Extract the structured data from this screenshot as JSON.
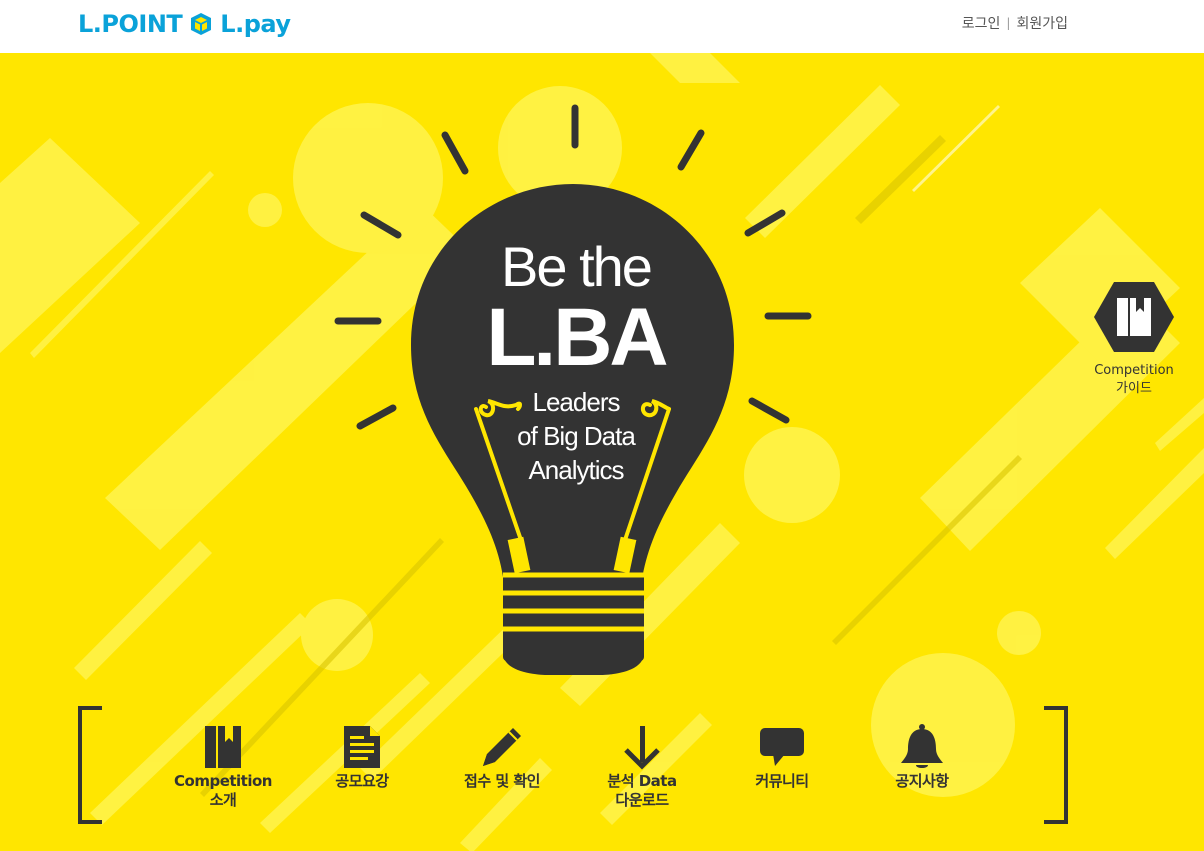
{
  "header": {
    "logo_lpoint": "L.POINT",
    "logo_lpay": "L.pay",
    "login": "로그인",
    "separator": "|",
    "signup": "회원가입"
  },
  "hero": {
    "title_line1": "Be the",
    "title_line2": "L.BA",
    "subtitle_line1": "Leaders",
    "subtitle_line2": "of Big Data",
    "subtitle_line3": "Analytics"
  },
  "guide": {
    "line1": "Competition",
    "line2": "가이드",
    "icon": "book-icon"
  },
  "menu": {
    "items": [
      {
        "line1": "Competition",
        "line2": "소개",
        "icon": "book-icon"
      },
      {
        "line1": "공모요강",
        "line2": "",
        "icon": "document-icon"
      },
      {
        "line1": "접수 및 확인",
        "line2": "",
        "icon": "pencil-icon"
      },
      {
        "line1": "분석 Data",
        "line2": "다운로드",
        "icon": "download-icon"
      },
      {
        "line1": "커뮤니티",
        "line2": "",
        "icon": "chat-icon"
      },
      {
        "line1": "공지사항",
        "line2": "",
        "icon": "bell-icon"
      }
    ]
  },
  "colors": {
    "brand_blue": "#0aa2d9",
    "hero_yellow": "#ffe600",
    "dark": "#333333"
  }
}
